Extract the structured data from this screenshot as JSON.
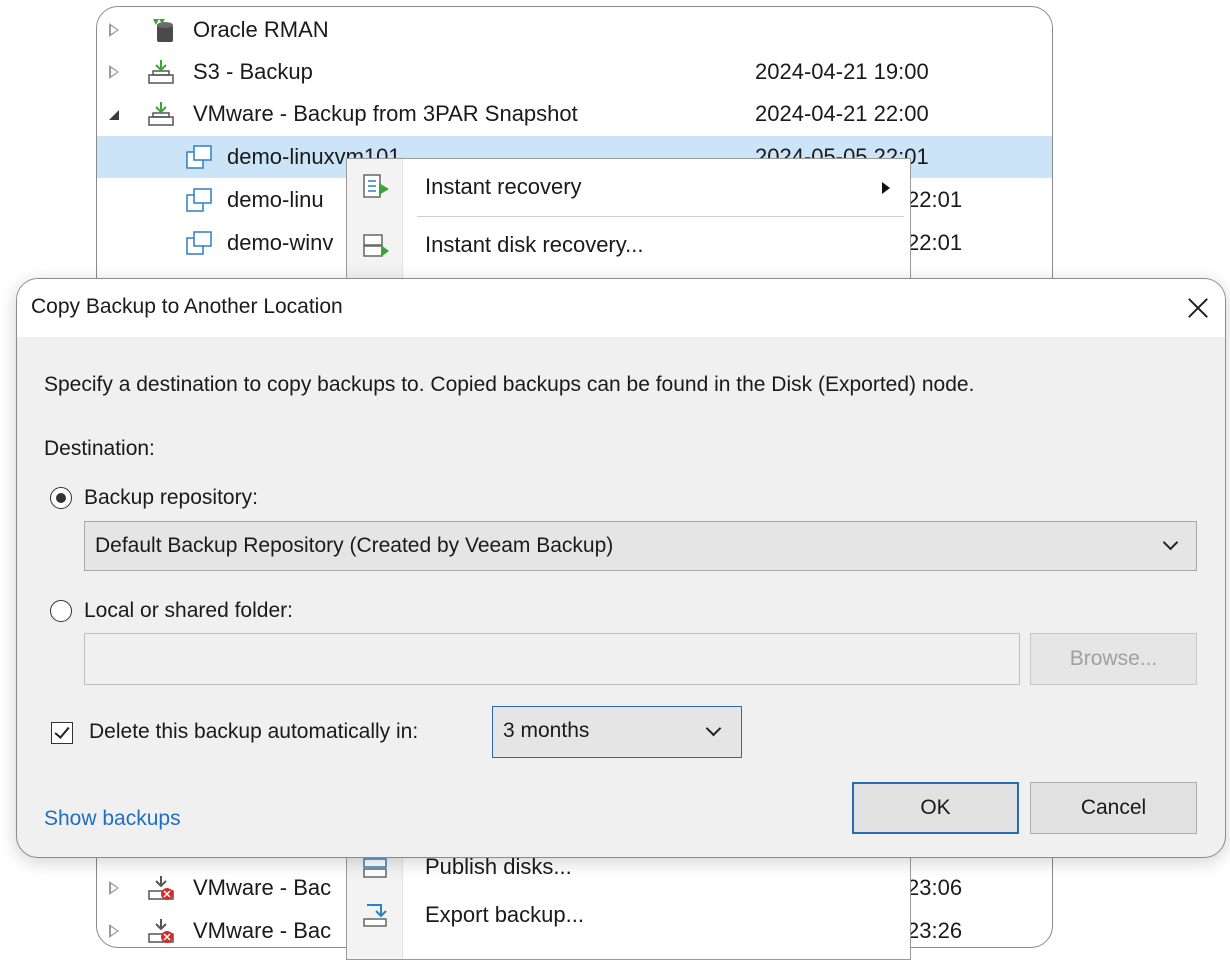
{
  "tree": {
    "rows": [
      {
        "label": "Oracle RMAN",
        "date": ""
      },
      {
        "label": "S3 - Backup",
        "date": "2024-04-21 19:00"
      },
      {
        "label": "VMware - Backup from 3PAR Snapshot",
        "date": "2024-04-21 22:00"
      },
      {
        "label": "demo-linuxvm101",
        "date": "2024-05-05 22:01"
      },
      {
        "label": "demo-linu",
        "date": "22:01"
      },
      {
        "label": "demo-winv",
        "date": "22:01"
      },
      {
        "label": "VMware - Bac",
        "date": "23:06"
      },
      {
        "label": "VMware - Bac",
        "date": "23:26"
      }
    ]
  },
  "context_menu": {
    "items": [
      {
        "label": "Instant recovery",
        "icon": "instant-recovery-icon",
        "has_submenu": true
      },
      {
        "label": "Instant disk recovery...",
        "icon": "instant-disk-recovery-icon"
      },
      {
        "label": "Publish disks...",
        "icon": "publish-disks-icon"
      },
      {
        "label": "Export backup...",
        "icon": "export-backup-icon"
      }
    ]
  },
  "dialog": {
    "title": "Copy Backup to Another Location",
    "description": "Specify a destination to copy backups to. Copied backups can be found in the Disk (Exported) node.",
    "destination_label": "Destination:",
    "repo_option_label": "Backup repository:",
    "repo_selected": "Default Backup Repository (Created by Veeam Backup)",
    "folder_option_label": "Local or shared folder:",
    "folder_value": "",
    "browse_label": "Browse...",
    "delete_label": "Delete this backup automatically in:",
    "delete_checked": true,
    "retention_selected": "3 months",
    "show_backups_label": "Show backups",
    "ok_label": "OK",
    "cancel_label": "Cancel"
  },
  "colors": {
    "selection": "#cce4f7",
    "link": "#1f6fbf",
    "dialog_bg": "#f0f0f0",
    "default_button_border": "#2b6cb0"
  }
}
